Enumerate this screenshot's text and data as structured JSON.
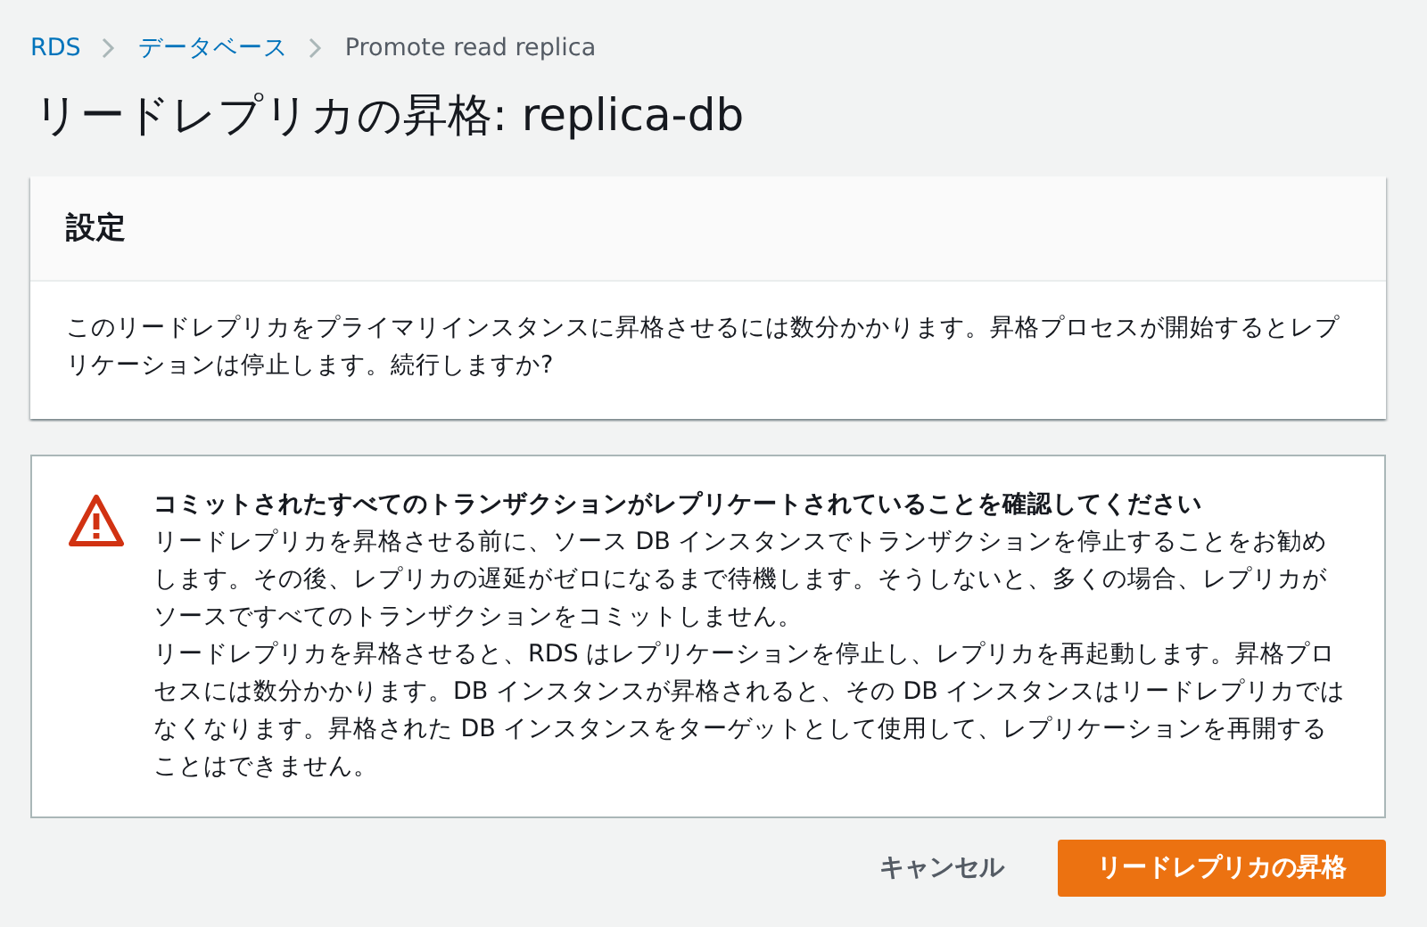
{
  "breadcrumbs": [
    {
      "label": "RDS",
      "kind": "link"
    },
    {
      "label": "データベース",
      "kind": "link"
    },
    {
      "label": "Promote read replica",
      "kind": "current"
    }
  ],
  "title": "リードレプリカの昇格: replica-db",
  "settings": {
    "heading": "設定",
    "text": "このリードレプリカをプライマリインスタンスに昇格させるには数分かかります。昇格プロセスが開始するとレプリケーションは停止します。続行しますか?"
  },
  "warning": {
    "heading": "コミットされたすべてのトランザクションがレプリケートされていることを確認してください",
    "paragraphs": [
      "リードレプリカを昇格させる前に、ソース DB インスタンスでトランザクションを停止することをお勧めします。その後、レプリカの遅延がゼロになるまで待機します。そうしないと、多くの場合、レプリカがソースですべてのトランザクションをコミットしません。",
      "リードレプリカを昇格させると、RDS はレプリケーションを停止し、レプリカを再起動します。昇格プロセスには数分かかります。DB インスタンスが昇格されると、その DB インスタンスはリードレプリカではなくなります。昇格された DB インスタンスをターゲットとして使用して、レプリケーションを再開することはできません。"
    ]
  },
  "buttons": [
    {
      "label": "キャンセル",
      "kind": "link"
    },
    {
      "label": "リードレプリカの昇格",
      "kind": "primary"
    }
  ]
}
